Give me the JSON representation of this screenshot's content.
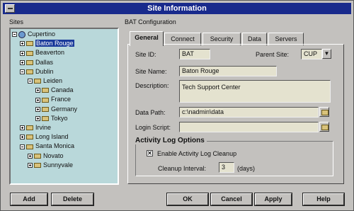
{
  "window": {
    "title": "Site Information"
  },
  "sites_label": "Sites",
  "config_label": "BAT Configuration",
  "tree": [
    {
      "label": "Cupertino",
      "icon": "globe-icon",
      "box": "minus",
      "level": 0
    },
    {
      "label": "Baton Rouge",
      "icon": "folder-icon",
      "box": "plus",
      "level": 1,
      "selected": true
    },
    {
      "label": "Beaverton",
      "icon": "folder-icon",
      "box": "plus",
      "level": 1
    },
    {
      "label": "Dallas",
      "icon": "folder-icon",
      "box": "plus",
      "level": 1
    },
    {
      "label": "Dublin",
      "icon": "folder-icon",
      "box": "minus",
      "level": 1
    },
    {
      "label": "Leiden",
      "icon": "folder-icon",
      "box": "minus",
      "level": 2
    },
    {
      "label": "Canada",
      "icon": "folder-icon",
      "box": "plus",
      "level": 3
    },
    {
      "label": "France",
      "icon": "folder-icon",
      "box": "plus",
      "level": 3
    },
    {
      "label": "Germany",
      "icon": "folder-icon",
      "box": "plus",
      "level": 3
    },
    {
      "label": "Tokyo",
      "icon": "folder-icon",
      "box": "plus",
      "level": 3
    },
    {
      "label": "Irvine",
      "icon": "folder-icon",
      "box": "plus",
      "level": 1
    },
    {
      "label": "Long Island",
      "icon": "folder-icon",
      "box": "plus",
      "level": 1
    },
    {
      "label": "Santa Monica",
      "icon": "folder-icon",
      "box": "minus",
      "level": 1
    },
    {
      "label": "Novato",
      "icon": "folder-icon",
      "box": "plus",
      "level": 2
    },
    {
      "label": "Sunnyvale",
      "icon": "folder-icon",
      "box": "plus",
      "level": 2
    }
  ],
  "tabs": [
    {
      "label": "General",
      "active": true
    },
    {
      "label": "Connect"
    },
    {
      "label": "Security"
    },
    {
      "label": "Data"
    },
    {
      "label": "Servers"
    }
  ],
  "form": {
    "site_id_label": "Site ID:",
    "site_id_value": "BAT",
    "parent_site_label": "Parent Site:",
    "parent_site_value": "CUP",
    "site_name_label": "Site Name:",
    "site_name_value": "Baton Rouge",
    "description_label": "Description:",
    "description_value": "Tech Support Center",
    "data_path_label": "Data Path:",
    "data_path_value": "c:\\nadmin\\data",
    "login_script_label": "Login Script:",
    "login_script_value": ""
  },
  "activity_log": {
    "title": "Activity Log Options",
    "enable_label": "Enable Activity Log Cleanup",
    "enable_checked": true,
    "cleanup_label": "Cleanup Interval:",
    "cleanup_value": "3",
    "cleanup_unit": "(days)"
  },
  "buttons": {
    "add": "Add",
    "delete": "Delete",
    "ok": "OK",
    "cancel": "Cancel",
    "apply": "Apply",
    "help": "Help"
  },
  "colors": {
    "titlebar": "#182a8c",
    "tree_bg": "#b9d8da",
    "selection": "#1a3a9a",
    "field_bg": "#e4e2cf",
    "window_bg": "#c3c1be"
  }
}
